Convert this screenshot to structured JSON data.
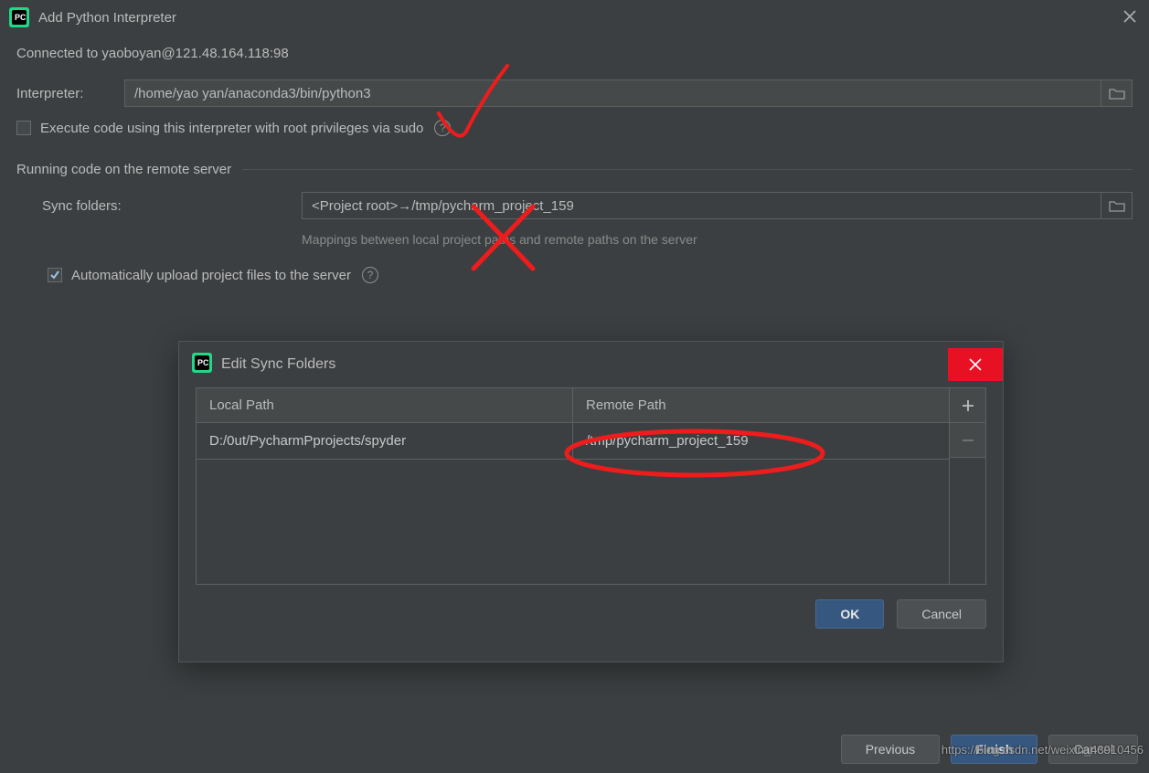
{
  "title": "Add Python Interpreter",
  "connected": "Connected to yaoboyan@121.48.164.118:98",
  "interpreter_label": "Interpreter:",
  "interpreter_value": "/home/yao    yan/anaconda3/bin/python3",
  "sudo_label": "Execute code using this interpreter with root privileges via sudo",
  "section_title": "Running code on the remote server",
  "sync_label": "Sync folders:",
  "sync_value": "<Project root>→/tmp/pycharm_project_159",
  "sync_hint": "Mappings between local project paths and remote paths on the server",
  "upload_label": "Automatically upload project files to the server",
  "modal": {
    "title": "Edit Sync Folders",
    "col_local": "Local Path",
    "col_remote": "Remote Path",
    "row_local": "D:/0ut/PycharmPprojects/spyder",
    "row_remote": "/tmp/pycharm_project_159",
    "ok": "OK",
    "cancel": "Cancel"
  },
  "bottom": {
    "previous": "Previous",
    "finish": "Finish",
    "cancel": "Cancel"
  },
  "watermark": "https://blog.csdn.net/weixin_43910456"
}
